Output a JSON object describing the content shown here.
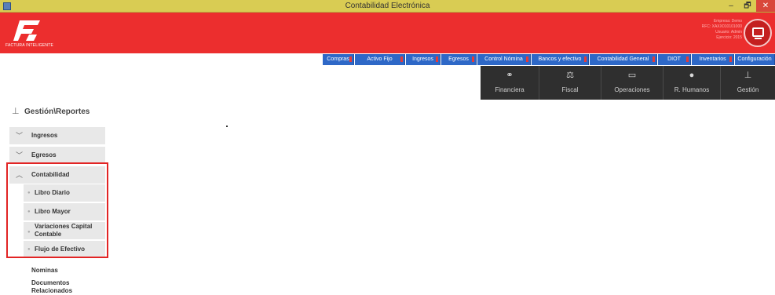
{
  "window": {
    "title": "Contabilidad Electrónica",
    "min": "–",
    "max": "🗗",
    "close": "✕"
  },
  "header": {
    "brand": "FACTURA INTELIGENTE",
    "user_lines": [
      "Empresa: Demo",
      "RFC: XAXX010101000",
      "Usuario: Admin",
      "Ejercicio: 2015"
    ]
  },
  "menu": [
    {
      "label": "Compras"
    },
    {
      "label": "Activo Fijo"
    },
    {
      "label": "Ingresos"
    },
    {
      "label": "Egresos"
    },
    {
      "label": "Control Nómina"
    },
    {
      "label": "Bancos y efectivo"
    },
    {
      "label": "Contabilidad General"
    },
    {
      "label": "DIOT"
    },
    {
      "label": "Inventarios"
    },
    {
      "label": "Configuración"
    }
  ],
  "tiles": [
    {
      "label": "Financiera",
      "icon": "coins-icon"
    },
    {
      "label": "Fiscal",
      "icon": "scale-icon"
    },
    {
      "label": "Operaciones",
      "icon": "monitor-icon"
    },
    {
      "label": "R. Humanos",
      "icon": "person-icon"
    },
    {
      "label": "Gestión",
      "icon": "org-chart-icon"
    }
  ],
  "breadcrumb": "Gestión\\Reportes",
  "sidebar": {
    "groups": [
      {
        "label": "Ingresos",
        "expanded": false
      },
      {
        "label": "Egresos",
        "expanded": false
      },
      {
        "label": "Contabilidad",
        "expanded": true
      }
    ],
    "contabilidad_items": [
      {
        "label": "Libro Diario"
      },
      {
        "label": "Libro Mayor"
      },
      {
        "label": "Variaciones Capital Contable"
      },
      {
        "label": "Flujo de Efectivo"
      }
    ],
    "other_items": [
      {
        "label": "Nominas"
      },
      {
        "label": "Documentos Relacionados"
      }
    ]
  },
  "colors": {
    "header": "#ec2e2e",
    "menu": "#2e68c7",
    "tiles": "#2f2f2f",
    "titlebar": "#d9cc53",
    "highlight": "#e22424"
  }
}
